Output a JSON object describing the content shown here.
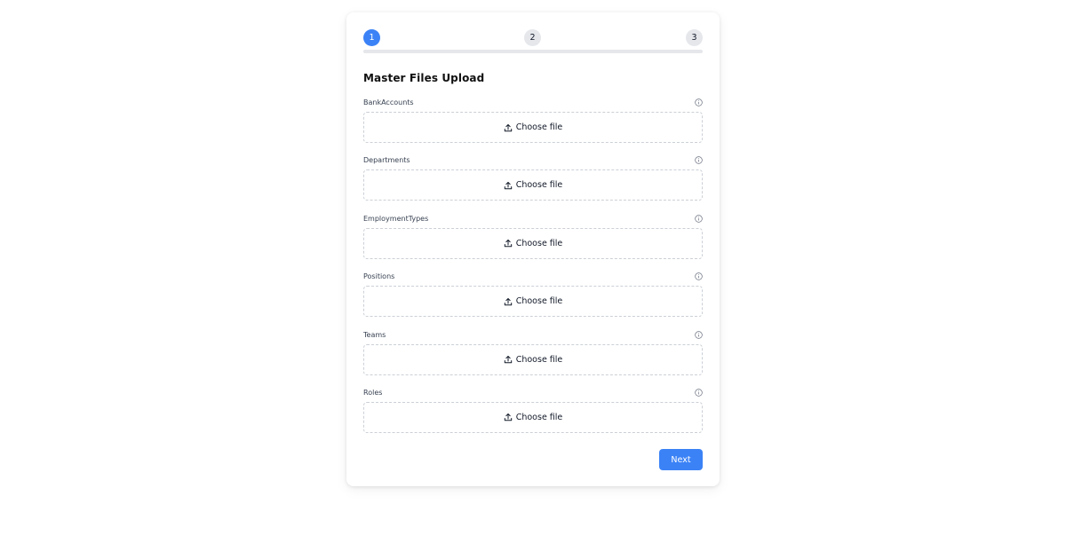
{
  "stepper": {
    "steps": [
      "1",
      "2",
      "3"
    ],
    "active_step": 1,
    "active_color": "#3b82f6",
    "inactive_color": "#e5e7eb"
  },
  "form": {
    "title": "Master Files Upload",
    "fields": [
      {
        "label": "BankAccounts",
        "button_label": "Choose file",
        "icon": "info-icon"
      },
      {
        "label": "Departments",
        "button_label": "Choose file",
        "icon": "info-icon"
      },
      {
        "label": "EmploymentTypes",
        "button_label": "Choose file",
        "icon": "info-icon"
      },
      {
        "label": "Positions",
        "button_label": "Choose file",
        "icon": "info-icon"
      },
      {
        "label": "Teams",
        "button_label": "Choose file",
        "icon": "info-icon"
      },
      {
        "label": "Roles",
        "button_label": "Choose file",
        "icon": "info-icon"
      }
    ],
    "upload_icon": "upload-icon"
  },
  "actions": {
    "next_label": "Next",
    "next_color": "#3b82f6"
  }
}
